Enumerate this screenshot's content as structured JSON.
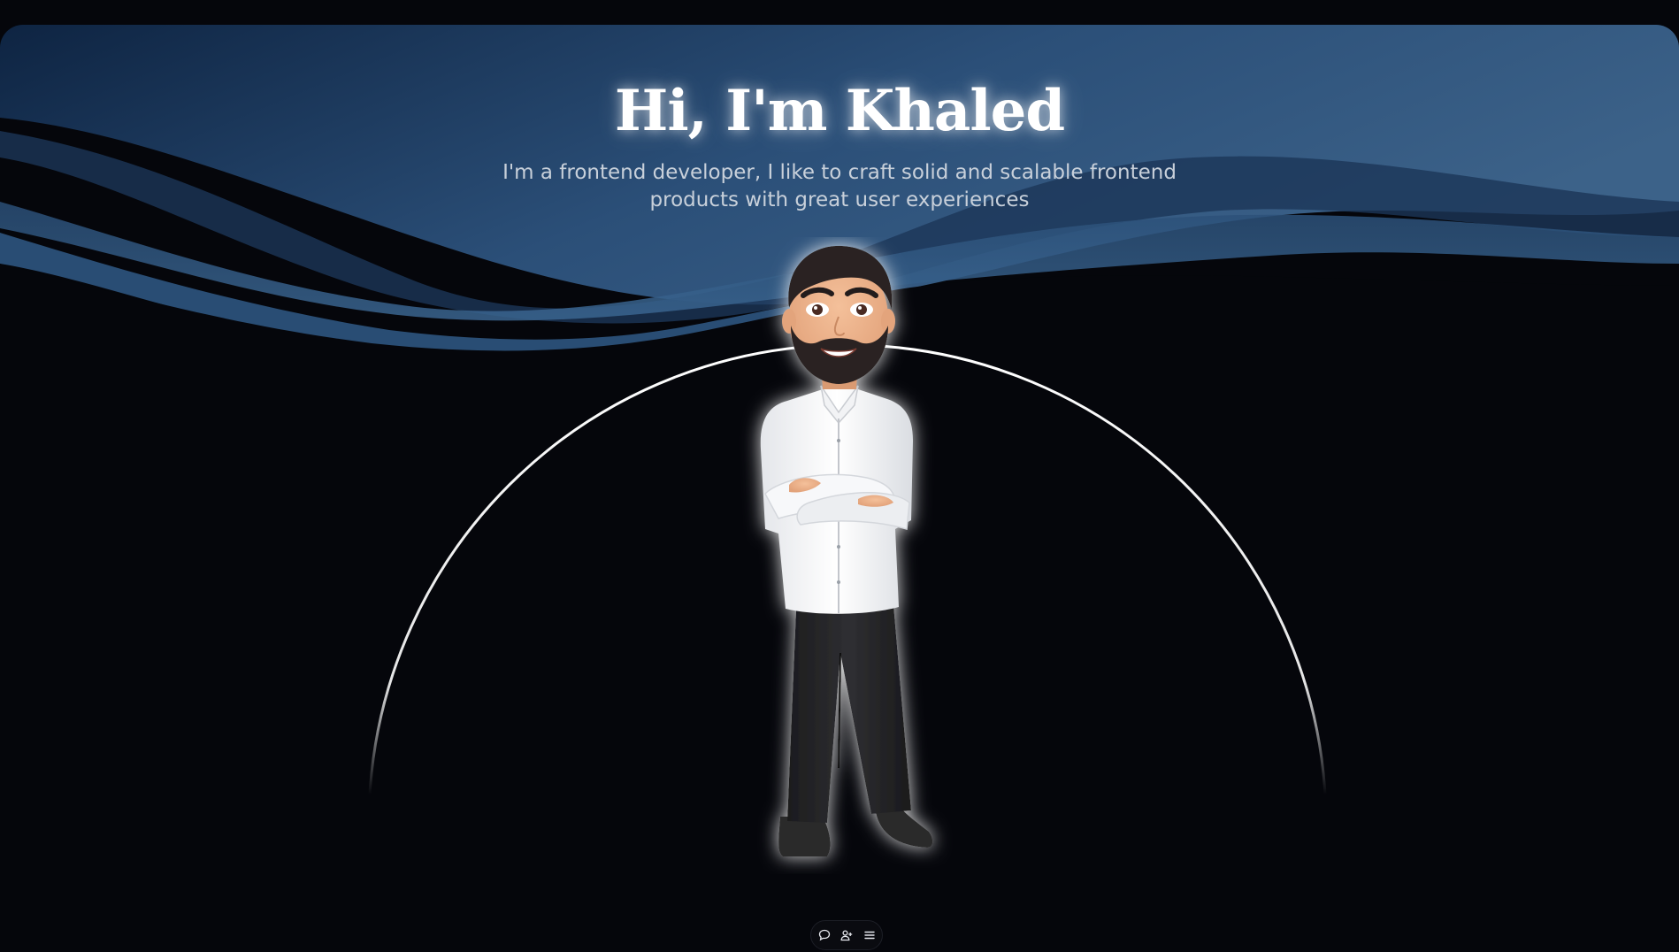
{
  "hero": {
    "title": "Hi, I'm Khaled",
    "subtitle": "I'm a frontend developer, I like to craft solid and scalable frontend products with great user experiences"
  },
  "dock": {
    "items": [
      {
        "icon": "chat-bubble-icon"
      },
      {
        "icon": "add-user-icon"
      },
      {
        "icon": "menu-icon"
      }
    ]
  },
  "colors": {
    "background": "#05060b",
    "wave_dark": "#0f2744",
    "wave_light": "#3a6189",
    "text": "#ffffff",
    "subtitle": "#c8d0da"
  }
}
